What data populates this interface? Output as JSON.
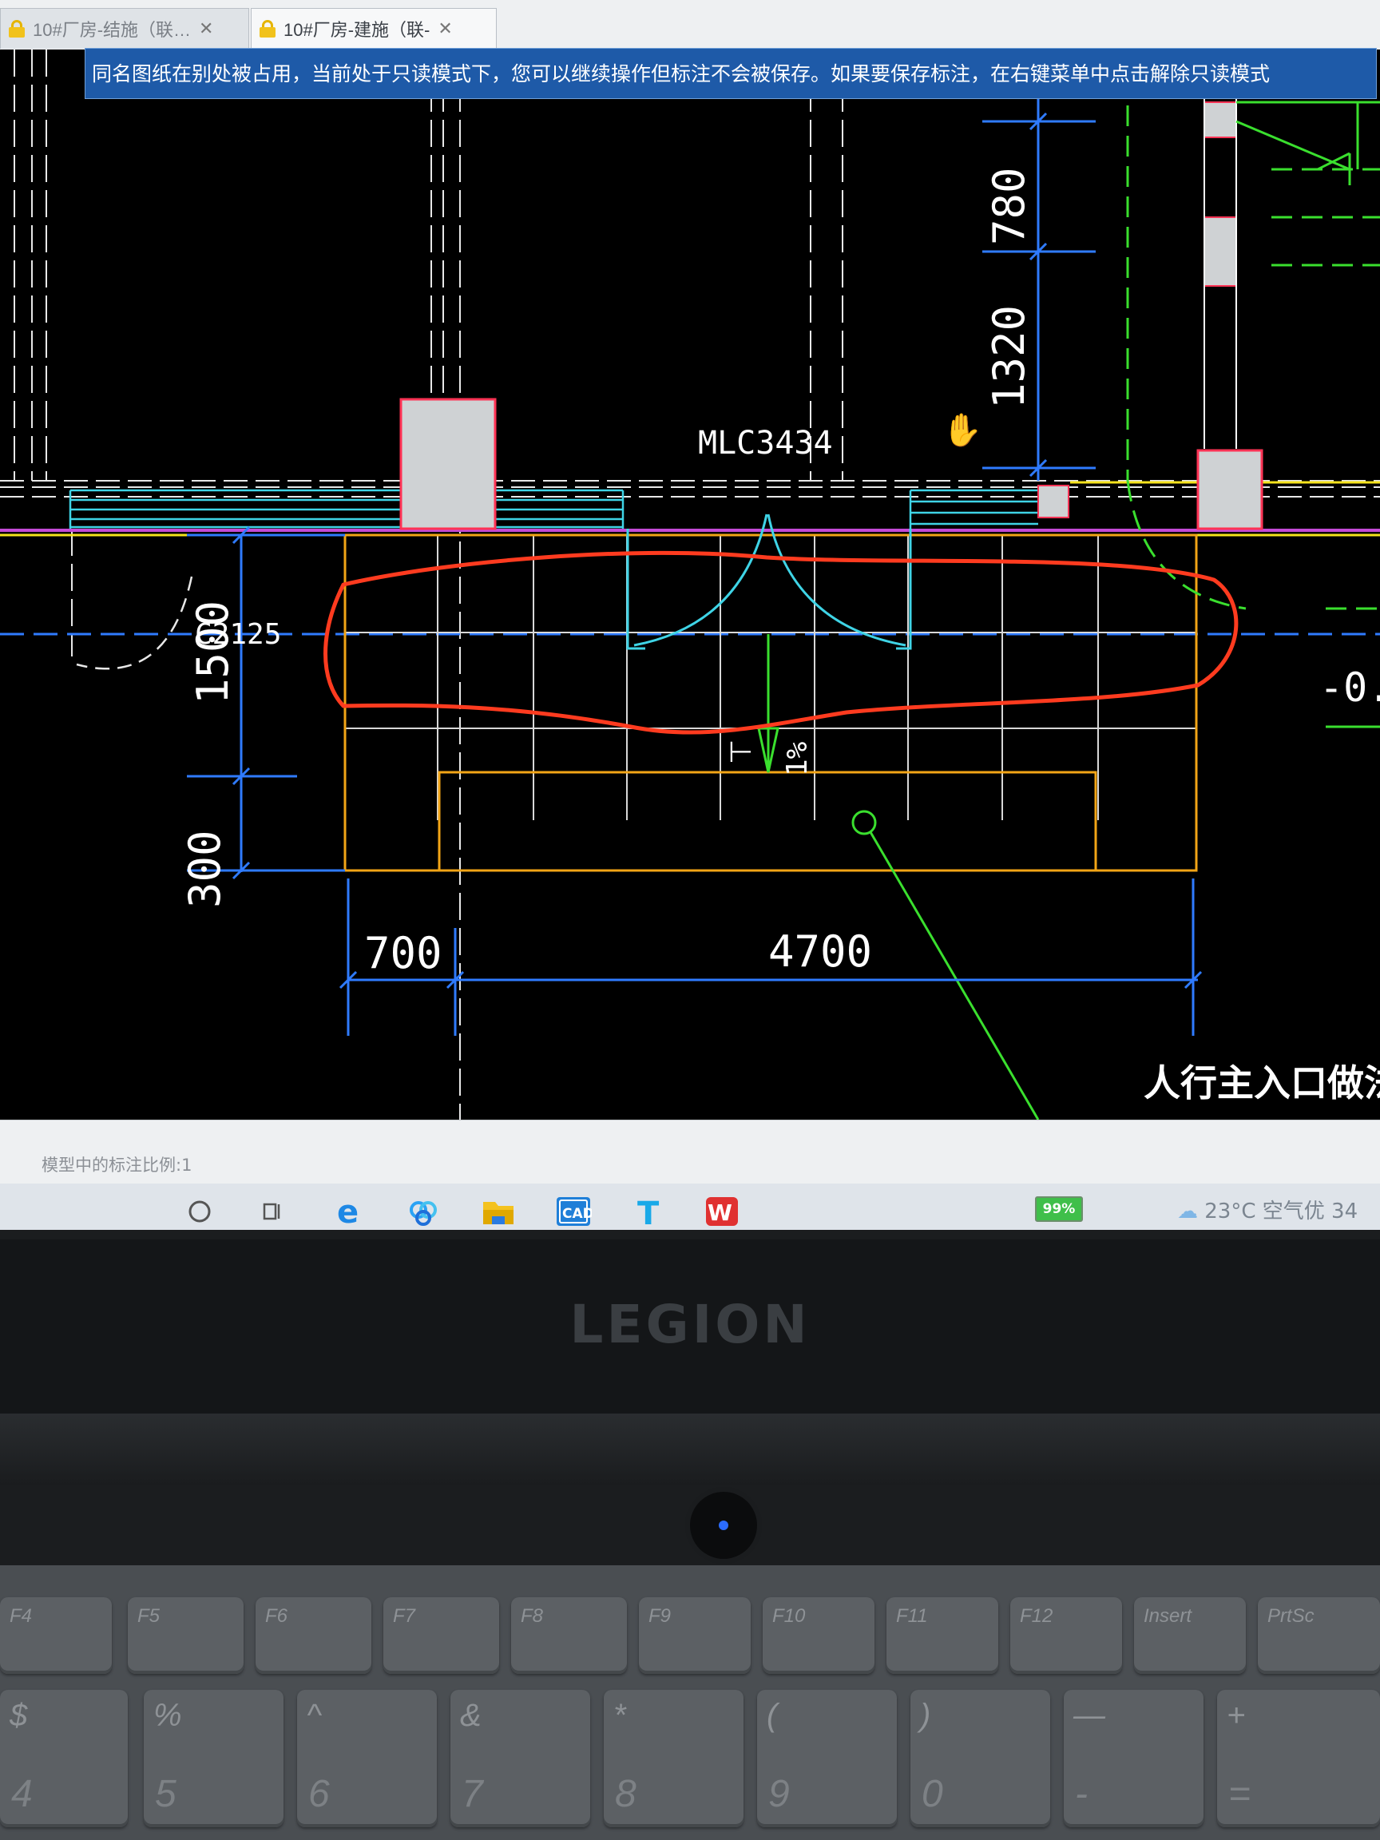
{
  "tabs": [
    {
      "label": "10#厂房-结施（联…",
      "close": "✕"
    },
    {
      "label": "10#厂房-建施（联-",
      "close": "✕"
    }
  ],
  "notice": "同名图纸在别处被占用，当前处于只读模式下，您可以继续操作但标注不会被保存。如果要保存标注，在右键菜单中点击解除只读模式",
  "drawing": {
    "dims": {
      "d780": "780",
      "d1320": "1320",
      "d1500": "1500",
      "d300": "300",
      "d700": "700",
      "d4700": "4700"
    },
    "labels": {
      "window": "MLC3434",
      "c2125": "C2125",
      "slope": "1%",
      "slope_arrow": "⊤",
      "elev": "-0.",
      "title": "人行主入口做法"
    }
  },
  "status": {
    "scale_text": "模型中的标注比例:1"
  },
  "taskbar": {
    "apps": [
      "cortana-icon",
      "task-view-icon",
      "edge-icon",
      "baidu-netdisk-icon",
      "file-explorer-icon",
      "cad-viewer-icon",
      "text-app-icon",
      "wps-icon"
    ],
    "cad_label": "CAD",
    "battery": "99%",
    "weather": "23°C  空气优 34"
  },
  "laptop": {
    "brand": "LEGION"
  },
  "keyboard": {
    "fkeys": [
      "F4",
      "F5",
      "F6",
      "F7",
      "F8",
      "F9",
      "F10",
      "F11",
      "F12",
      "Insert",
      "PrtSc"
    ],
    "numkeys": [
      {
        "top": "$",
        "bottom": "4"
      },
      {
        "top": "%",
        "bottom": "5"
      },
      {
        "top": "^",
        "bottom": "6"
      },
      {
        "top": "&",
        "bottom": "7"
      },
      {
        "top": "*",
        "bottom": "8"
      },
      {
        "top": "(",
        "bottom": "9"
      },
      {
        "top": ")",
        "bottom": "0"
      },
      {
        "top": "—",
        "bottom": "-"
      },
      {
        "top": "+",
        "bottom": "="
      }
    ]
  },
  "colors": {
    "dimension": "#2f7bff",
    "cyan": "#3fd4e6",
    "orange": "#f2a516",
    "yellow": "#f5e21c",
    "magenta": "#c44ad6",
    "green": "#3adf2e",
    "markup_red": "#ff3b1f",
    "gray_fill": "#cfd2d4",
    "notice_bg": "#1e5aa8"
  }
}
